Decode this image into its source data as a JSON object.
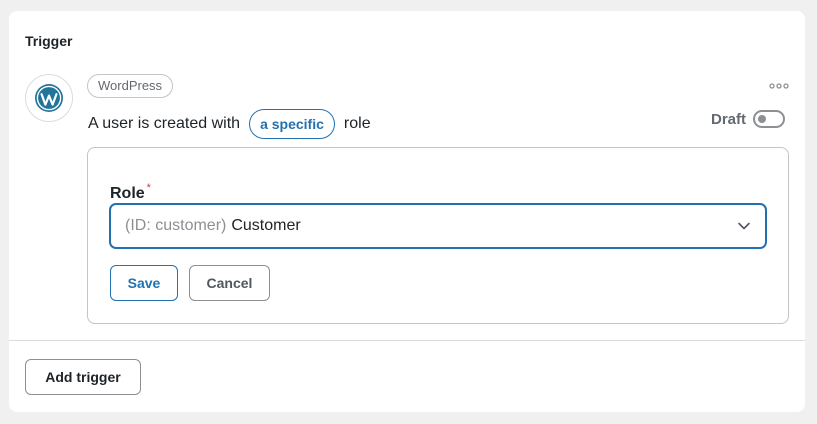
{
  "section": {
    "title": "Trigger"
  },
  "integration": {
    "name": "WordPress",
    "icon": "wordpress-logo-icon"
  },
  "sentence": {
    "before": "A user is created with",
    "token": "a specific",
    "after": "role"
  },
  "status": {
    "label": "Draft",
    "enabled": false
  },
  "form": {
    "field_label": "Role",
    "required_mark": "*",
    "select": {
      "prefix": "(ID: customer)",
      "value": "Customer"
    },
    "save_label": "Save",
    "cancel_label": "Cancel"
  },
  "footer": {
    "add_trigger_label": "Add trigger"
  },
  "colors": {
    "accent": "#2271b1",
    "required": "#d63638",
    "muted": "#646970"
  }
}
